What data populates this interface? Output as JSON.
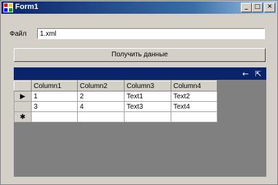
{
  "window": {
    "title": "Form1",
    "minimize_glyph": "_",
    "maximize_glyph": "□",
    "close_glyph": "✕"
  },
  "form": {
    "file_label": "Файл",
    "file_value": "1.xml",
    "get_data_button": "Получить данные"
  },
  "grid": {
    "caption_icons": "← ⇱",
    "columns": [
      "Column1",
      "Column2",
      "Column3",
      "Column4"
    ],
    "rows": [
      {
        "indicator": "▶",
        "cells": [
          "1",
          "2",
          "Text1",
          "Text2"
        ]
      },
      {
        "indicator": "",
        "cells": [
          "3",
          "4",
          "Text3",
          "Text4"
        ]
      }
    ],
    "new_row_indicator": "✱"
  },
  "colors": {
    "title_active": "#0a246a",
    "grid_caption": "#0a246a",
    "grid_background": "#808080",
    "window_face": "#d4d0c8"
  }
}
